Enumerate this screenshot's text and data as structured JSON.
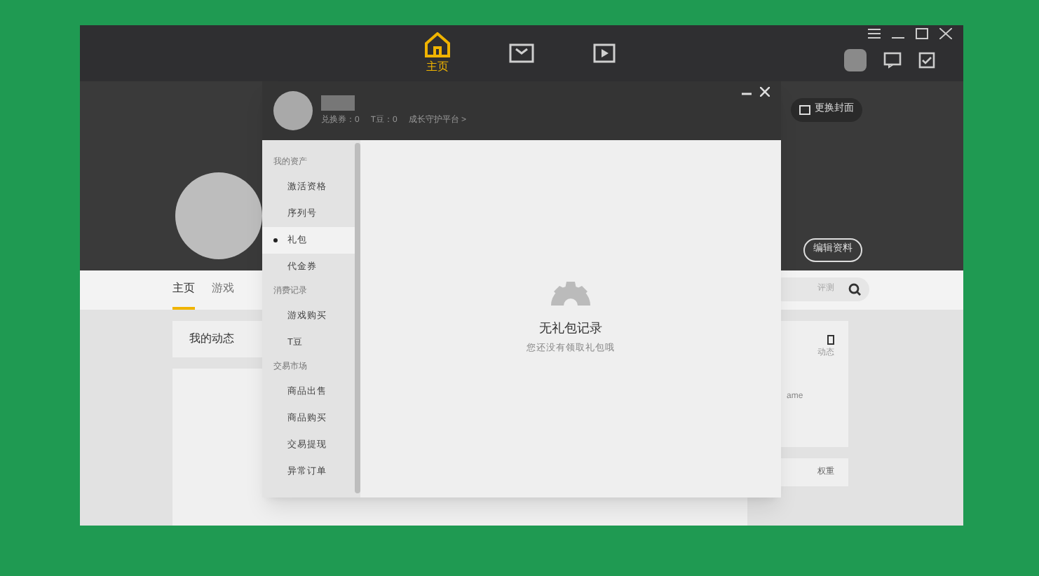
{
  "top_nav": [
    {
      "kind": "home",
      "label": "主页",
      "selected": true
    },
    {
      "kind": "bag",
      "selected": false
    },
    {
      "kind": "play",
      "selected": false
    }
  ],
  "banner": {
    "change_cover": "更换封面",
    "edit_profile": "编辑资料"
  },
  "page_tabs": [
    {
      "label": "主页",
      "selected": true
    },
    {
      "label": "游戏",
      "selected": false
    }
  ],
  "search": {
    "placeholder": "评测"
  },
  "feed": {
    "title": "我的动态"
  },
  "side_card": {
    "stat_label": "动态",
    "name": "ame",
    "footer": "权重"
  },
  "dialog": {
    "stats": [
      "兑换券：0",
      "T豆：0"
    ],
    "link": "成长守护平台 >",
    "groups": [
      {
        "title": "我的资产",
        "items": [
          {
            "label": "激活资格",
            "selected": false
          },
          {
            "label": "序列号",
            "selected": false
          },
          {
            "label": "礼包",
            "selected": true
          },
          {
            "label": "代金券",
            "selected": false
          }
        ]
      },
      {
        "title": "消费记录",
        "items": [
          {
            "label": "游戏购买",
            "selected": false
          },
          {
            "label": "T豆",
            "selected": false
          }
        ]
      },
      {
        "title": "交易市场",
        "items": [
          {
            "label": "商品出售",
            "selected": false
          },
          {
            "label": "商品购买",
            "selected": false
          },
          {
            "label": "交易提现",
            "selected": false
          },
          {
            "label": "异常订单",
            "selected": false
          }
        ]
      }
    ],
    "empty_title": "无礼包记录",
    "empty_hint": "您还没有领取礼包哦"
  }
}
